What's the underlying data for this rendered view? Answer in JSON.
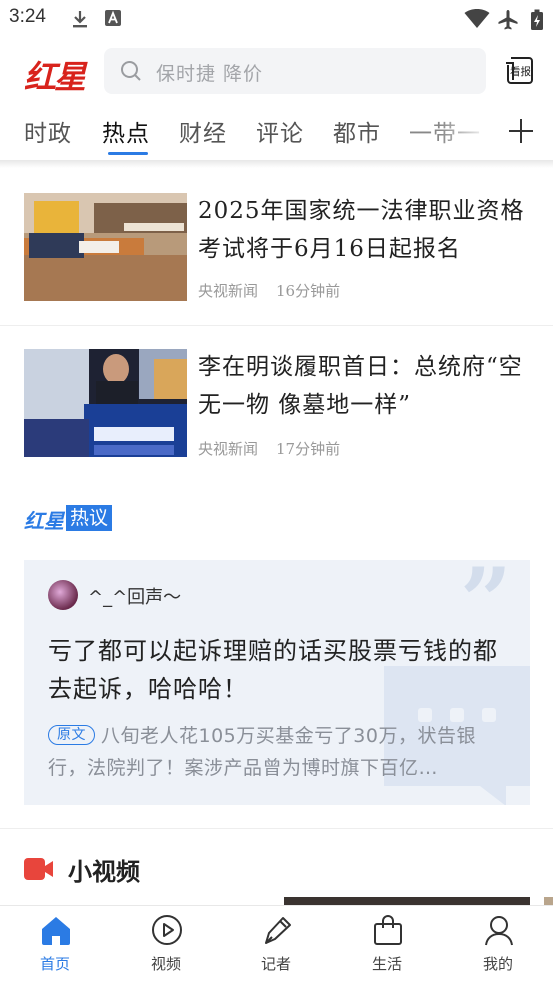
{
  "status_bar": {
    "time": "3:24"
  },
  "header": {
    "logo": "红星",
    "search_placeholder": "保时捷 降价",
    "kanbao_label": "看报"
  },
  "tabs": [
    {
      "label": "时政"
    },
    {
      "label": "热点",
      "active": true
    },
    {
      "label": "财经"
    },
    {
      "label": "评论"
    },
    {
      "label": "都市"
    },
    {
      "label": "一带一"
    }
  ],
  "news": [
    {
      "title": "2025年国家统一法律职业资格考试将于6月16日起报名",
      "source": "央视新闻",
      "time": "16分钟前"
    },
    {
      "title": "李在明谈履职首日：总统府“空无一物 像墓地一样”",
      "source": "央视新闻",
      "time": "17分钟前"
    }
  ],
  "hot": {
    "logo": "红星",
    "badge": "热议",
    "user": "^_^回声～",
    "comment": "亏了都可以起诉理赔的话买股票亏钱的都去起诉，哈哈哈！",
    "orig_tag": "原文",
    "source_text": "八旬老人花105万买基金亏了30万，状告银行，法院判了！案涉产品曾为博时旗下百亿…"
  },
  "video": {
    "title": "小视频"
  },
  "bottom_nav": [
    {
      "label": "首页",
      "icon": "home-icon",
      "active": true
    },
    {
      "label": "视频",
      "icon": "play-icon"
    },
    {
      "label": "记者",
      "icon": "pen-icon"
    },
    {
      "label": "生活",
      "icon": "bag-icon"
    },
    {
      "label": "我的",
      "icon": "user-icon"
    }
  ],
  "colors": {
    "brand_red": "#d8231c",
    "accent_blue": "#2b7be4"
  }
}
